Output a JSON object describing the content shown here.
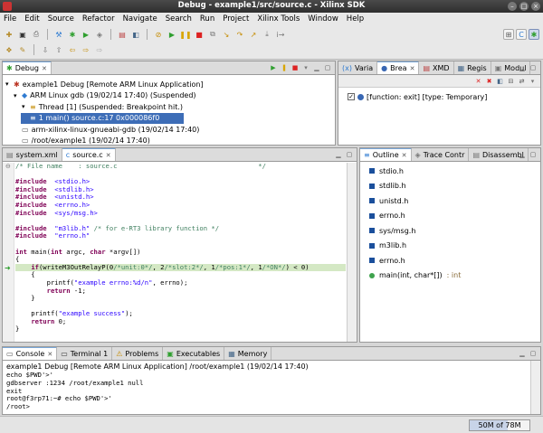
{
  "window": {
    "title": "Debug - example1/src/source.c - Xilinx SDK"
  },
  "menu": [
    "File",
    "Edit",
    "Source",
    "Refactor",
    "Navigate",
    "Search",
    "Run",
    "Project",
    "Xilinx Tools",
    "Window",
    "Help"
  ],
  "debug_view": {
    "tab_label": "Debug",
    "tree": [
      {
        "text": "example1 Debug [Remote ARM Linux Application]",
        "level": 0,
        "icon": "launch-icon"
      },
      {
        "text": "ARM Linux gdb (19/02/14 17:40) (Suspended)",
        "level": 1,
        "icon": "debug-target-icon"
      },
      {
        "text": "Thread [1] (Suspended: Breakpoint hit.)",
        "level": 2,
        "icon": "thread-icon"
      },
      {
        "text": "1 main() source.c:17 0x000086f0",
        "level": 3,
        "icon": "stack-frame-icon",
        "selected": true
      },
      {
        "text": "arm-xilinx-linux-gnueabi-gdb (19/02/14 17:40)",
        "level": 1,
        "icon": "process-icon"
      },
      {
        "text": "/root/example1 (19/02/14 17:40)",
        "level": 1,
        "icon": "process-icon"
      }
    ]
  },
  "bp_view": {
    "tabs": [
      {
        "label": "Varia",
        "active": false
      },
      {
        "label": "Brea",
        "active": true
      },
      {
        "label": "XMD",
        "active": false
      },
      {
        "label": "Regis",
        "active": false
      },
      {
        "label": "Modul",
        "active": false
      }
    ],
    "breakpoint": "[function: exit] [type: Temporary]",
    "checked": true
  },
  "editor": {
    "tabs": [
      {
        "label": "system.xml",
        "active": false
      },
      {
        "label": "source.c",
        "active": true
      }
    ],
    "lines": [
      [
        [
          "cm",
          "/* File name    : source.c                                    */"
        ]
      ],
      [],
      [
        [
          "kw",
          "#include"
        ],
        [
          "",
          "  "
        ],
        [
          "str",
          "<stdio.h>"
        ]
      ],
      [
        [
          "kw",
          "#include"
        ],
        [
          "",
          "  "
        ],
        [
          "str",
          "<stdlib.h>"
        ]
      ],
      [
        [
          "kw",
          "#include"
        ],
        [
          "",
          "  "
        ],
        [
          "str",
          "<unistd.h>"
        ]
      ],
      [
        [
          "kw",
          "#include"
        ],
        [
          "",
          "  "
        ],
        [
          "str",
          "<errno.h>"
        ]
      ],
      [
        [
          "kw",
          "#include"
        ],
        [
          "",
          "  "
        ],
        [
          "str",
          "<sys/msg.h>"
        ]
      ],
      [],
      [
        [
          "kw",
          "#include"
        ],
        [
          "",
          "  "
        ],
        [
          "str",
          "\"m3lib.h\""
        ],
        [
          "",
          " "
        ],
        [
          "cm",
          "/* for e-RT3 library function */"
        ]
      ],
      [
        [
          "kw",
          "#include"
        ],
        [
          "",
          "  "
        ],
        [
          "str",
          "\"errno.h\""
        ]
      ],
      [],
      [
        [
          "kw",
          "int"
        ],
        [
          "",
          " main("
        ],
        [
          "kw",
          "int"
        ],
        [
          "",
          " argc, "
        ],
        [
          "kw",
          "char"
        ],
        [
          "",
          " *argv[])"
        ]
      ],
      [
        [
          "",
          "{"
        ]
      ],
      [
        [
          "",
          "    "
        ],
        [
          "kw",
          "if"
        ],
        [
          "",
          "(writeM3OutRelayP("
        ],
        [
          "",
          "0"
        ],
        [
          "cm",
          "/*unit:0*/"
        ],
        [
          "",
          ", 2"
        ],
        [
          "cm",
          "/*slot:2*/"
        ],
        [
          "",
          ", 1"
        ],
        [
          "cm",
          "/*pos:1*/"
        ],
        [
          "",
          ", 1"
        ],
        [
          "cm",
          "/*ON*/"
        ],
        [
          "",
          ") < 0)"
        ]
      ],
      [
        [
          "",
          "    {"
        ]
      ],
      [
        [
          "",
          "        printf("
        ],
        [
          "str",
          "\"example errno:%d/n\""
        ],
        [
          "",
          ", errno);"
        ]
      ],
      [
        [
          "",
          "        "
        ],
        [
          "kw",
          "return"
        ],
        [
          "",
          " -1;"
        ]
      ],
      [
        [
          "",
          "    }"
        ]
      ],
      [],
      [
        [
          "",
          "    printf("
        ],
        [
          "str",
          "\"example success\""
        ],
        [
          "",
          ");"
        ]
      ],
      [
        [
          "",
          "    "
        ],
        [
          "kw",
          "return"
        ],
        [
          "",
          " 0;"
        ]
      ],
      [
        [
          "",
          "}"
        ]
      ]
    ],
    "current_line": 13
  },
  "outline_view": {
    "tabs": [
      {
        "label": "Outline",
        "active": true
      },
      {
        "label": "Trace Contr",
        "active": false
      },
      {
        "label": "Disassembl",
        "active": false
      }
    ],
    "items": [
      {
        "text": "stdio.h",
        "kind": "include"
      },
      {
        "text": "stdlib.h",
        "kind": "include"
      },
      {
        "text": "unistd.h",
        "kind": "include"
      },
      {
        "text": "errno.h",
        "kind": "include"
      },
      {
        "text": "sys/msg.h",
        "kind": "include"
      },
      {
        "text": "m3lib.h",
        "kind": "include"
      },
      {
        "text": "errno.h",
        "kind": "include"
      },
      {
        "text": "main(int, char*[])",
        "suffix": " : int",
        "kind": "function"
      }
    ]
  },
  "console_view": {
    "tabs": [
      {
        "label": "Console",
        "active": true
      },
      {
        "label": "Terminal 1",
        "active": false
      },
      {
        "label": "Problems",
        "active": false
      },
      {
        "label": "Executables",
        "active": false
      },
      {
        "label": "Memory",
        "active": false
      }
    ],
    "header": "example1 Debug [Remote ARM Linux Application] /root/example1 (19/02/14 17:40)",
    "lines": [
      "echo $PWD'>'",
      "gdbserver :1234 /root/example1 null",
      "exit",
      "root@f3rp71:~# echo $PWD'>'",
      "/root>"
    ]
  },
  "status": {
    "heap": "50M of 78M",
    "heap_fraction": 0.64
  }
}
